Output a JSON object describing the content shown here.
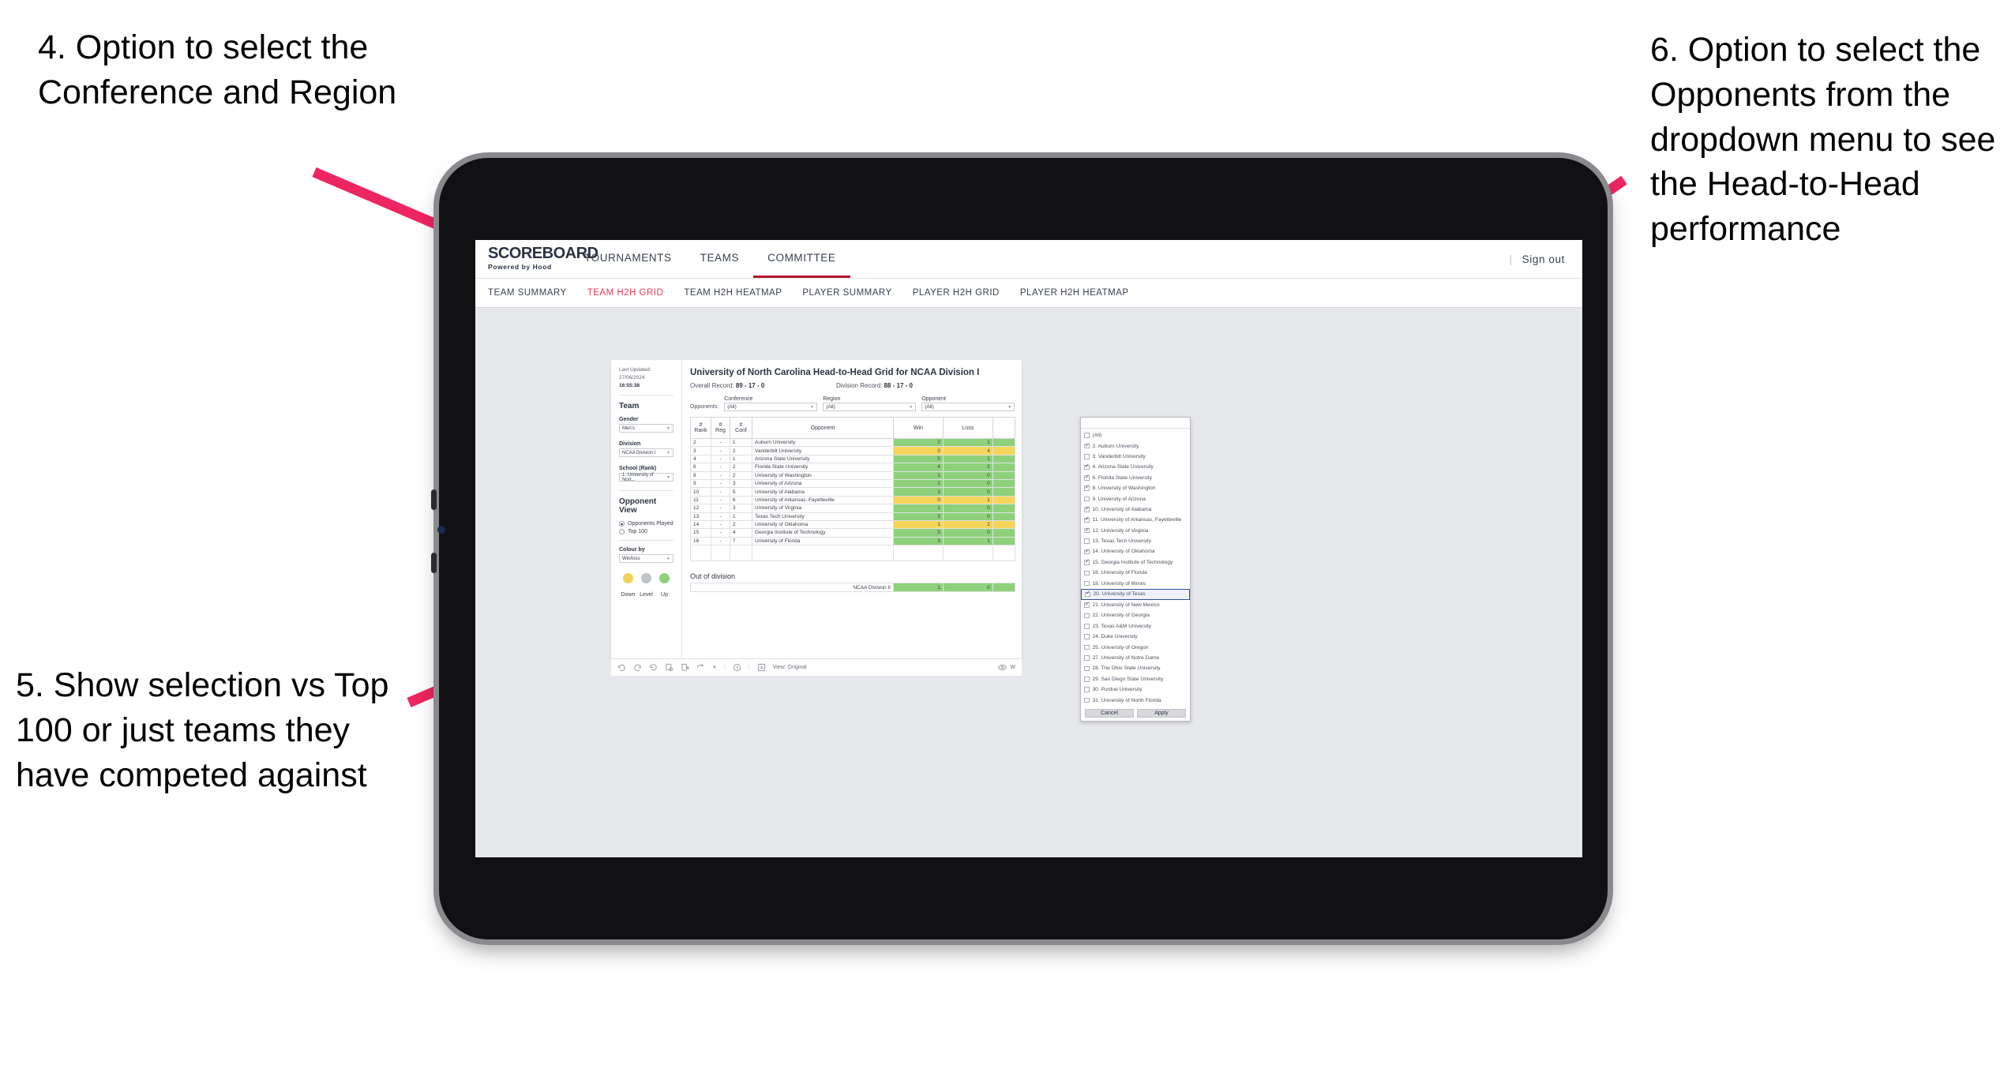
{
  "annotations": {
    "a4": "4. Option to select the Conference and Region",
    "a5": "5. Show selection vs Top 100 or just teams they have competed against",
    "a6": "6. Option to select the Opponents from the dropdown menu to see the Head-to-Head performance"
  },
  "colors": {
    "arrow": "#ED2560",
    "accent_red": "#B3152C",
    "active_tab": "#E8395C",
    "up_green": "#8ED17A",
    "down_yellow": "#F6D65A",
    "level_grey": "#BFC2C6",
    "desktop_bg": "#E7E8EC"
  },
  "app": {
    "brand": {
      "name": "SCOREBOARD",
      "tagline": "Powered by Hood"
    },
    "topnav": [
      {
        "label": "TOURNAMENTS",
        "active": false
      },
      {
        "label": "TEAMS",
        "active": false
      },
      {
        "label": "COMMITTEE",
        "active": true
      }
    ],
    "signout": {
      "divider": "|",
      "label": "Sign out"
    },
    "subnav": [
      {
        "label": "TEAM SUMMARY",
        "active": false
      },
      {
        "label": "TEAM H2H GRID",
        "active": true
      },
      {
        "label": "TEAM H2H HEATMAP",
        "active": false
      },
      {
        "label": "PLAYER SUMMARY",
        "active": false
      },
      {
        "label": "PLAYER H2H GRID",
        "active": false
      },
      {
        "label": "PLAYER H2H HEATMAP",
        "active": false
      }
    ]
  },
  "sidebar": {
    "last_updated_label": "Last Updated: 27/06/2024",
    "last_updated_time": "16:55:38",
    "team_heading": "Team",
    "gender_label": "Gender",
    "gender_value": "Men's",
    "division_label": "Division",
    "division_value": "NCAA Division I",
    "school_label": "School (Rank)",
    "school_value": "1. University of Nort...",
    "opponent_view_heading": "Opponent View",
    "opponent_view_options": [
      {
        "label": "Opponents Played",
        "selected": true
      },
      {
        "label": "Top 100",
        "selected": false
      }
    ],
    "colour_by_label": "Colour by",
    "colour_by_value": "Win/loss",
    "legend": [
      {
        "label": "Down",
        "color": "#F2D15B"
      },
      {
        "label": "Level",
        "color": "#BFC2C6"
      },
      {
        "label": "Up",
        "color": "#8ED17A"
      }
    ]
  },
  "main": {
    "title": "University of North Carolina Head-to-Head Grid for NCAA Division I",
    "overall_record_label": "Overall Record:",
    "overall_record_value": "89 - 17 - 0",
    "division_record_label": "Division Record:",
    "division_record_value": "88 - 17 - 0",
    "opponents_label": "Opponents:",
    "filters": [
      {
        "label": "Conference",
        "value": "(All)"
      },
      {
        "label": "Region",
        "value": "(All)"
      },
      {
        "label": "Opponent",
        "value": "(All)"
      }
    ],
    "columns": [
      "# Rank",
      "# Reg",
      "# Conf",
      "Opponent",
      "Win",
      "Loss"
    ],
    "column_head_lines": [
      [
        "#",
        "Rank"
      ],
      [
        "#",
        "Reg"
      ],
      [
        "#",
        "Conf"
      ],
      [
        "",
        "Opponent"
      ],
      [
        "",
        "Win"
      ],
      [
        "",
        "Loss"
      ]
    ],
    "rows": [
      {
        "rank": "2",
        "reg": "-",
        "conf": "1",
        "opponent": "Auburn University",
        "win": "2",
        "loss": "1",
        "state": "up"
      },
      {
        "rank": "3",
        "reg": "-",
        "conf": "2",
        "opponent": "Vanderbilt University",
        "win": "0",
        "loss": "4",
        "state": "down"
      },
      {
        "rank": "4",
        "reg": "-",
        "conf": "1",
        "opponent": "Arizona State University",
        "win": "5",
        "loss": "1",
        "state": "up"
      },
      {
        "rank": "6",
        "reg": "-",
        "conf": "2",
        "opponent": "Florida State University",
        "win": "4",
        "loss": "2",
        "state": "up"
      },
      {
        "rank": "8",
        "reg": "-",
        "conf": "2",
        "opponent": "University of Washington",
        "win": "1",
        "loss": "0",
        "state": "up"
      },
      {
        "rank": "9",
        "reg": "-",
        "conf": "3",
        "opponent": "University of Arizona",
        "win": "1",
        "loss": "0",
        "state": "up"
      },
      {
        "rank": "10",
        "reg": "-",
        "conf": "5",
        "opponent": "University of Alabama",
        "win": "3",
        "loss": "0",
        "state": "up"
      },
      {
        "rank": "11",
        "reg": "-",
        "conf": "6",
        "opponent": "University of Arkansas, Fayetteville",
        "win": "0",
        "loss": "1",
        "state": "down"
      },
      {
        "rank": "12",
        "reg": "-",
        "conf": "3",
        "opponent": "University of Virginia",
        "win": "1",
        "loss": "0",
        "state": "up"
      },
      {
        "rank": "13",
        "reg": "-",
        "conf": "1",
        "opponent": "Texas Tech University",
        "win": "3",
        "loss": "0",
        "state": "up"
      },
      {
        "rank": "14",
        "reg": "-",
        "conf": "2",
        "opponent": "University of Oklahoma",
        "win": "1",
        "loss": "2",
        "state": "down"
      },
      {
        "rank": "15",
        "reg": "-",
        "conf": "4",
        "opponent": "Georgia Institute of Technology",
        "win": "5",
        "loss": "0",
        "state": "up"
      },
      {
        "rank": "16",
        "reg": "-",
        "conf": "7",
        "opponent": "University of Florida",
        "win": "3",
        "loss": "1",
        "state": "up"
      }
    ],
    "out_of_division_heading": "Out of division",
    "out_of_division_row": {
      "label": "NCAA Division II",
      "win": "1",
      "loss": "0",
      "state": "up"
    }
  },
  "opponent_dropdown": {
    "items": [
      {
        "label": "(All)",
        "checked": false,
        "highlighted": false
      },
      {
        "label": "2. Auburn University",
        "checked": true,
        "highlighted": false
      },
      {
        "label": "3. Vanderbilt University",
        "checked": false,
        "highlighted": false
      },
      {
        "label": "4. Arizona State University",
        "checked": true,
        "highlighted": false
      },
      {
        "label": "6. Florida State University",
        "checked": true,
        "highlighted": false
      },
      {
        "label": "8. University of Washington",
        "checked": true,
        "highlighted": false
      },
      {
        "label": "9. University of Arizona",
        "checked": false,
        "highlighted": false
      },
      {
        "label": "10. University of Alabama",
        "checked": true,
        "highlighted": false
      },
      {
        "label": "11. University of Arkansas, Fayetteville",
        "checked": true,
        "highlighted": false
      },
      {
        "label": "12. University of Virginia",
        "checked": true,
        "highlighted": false
      },
      {
        "label": "13. Texas Tech University",
        "checked": false,
        "highlighted": false
      },
      {
        "label": "14. University of Oklahoma",
        "checked": true,
        "highlighted": false
      },
      {
        "label": "15. Georgia Institute of Technology",
        "checked": true,
        "highlighted": false
      },
      {
        "label": "16. University of Florida",
        "checked": false,
        "highlighted": false
      },
      {
        "label": "18. University of Illinois",
        "checked": false,
        "highlighted": false
      },
      {
        "label": "20. University of Texas",
        "checked": true,
        "highlighted": true
      },
      {
        "label": "21. University of New Mexico",
        "checked": true,
        "highlighted": false
      },
      {
        "label": "22. University of Georgia",
        "checked": false,
        "highlighted": false
      },
      {
        "label": "23. Texas A&M University",
        "checked": false,
        "highlighted": false
      },
      {
        "label": "24. Duke University",
        "checked": false,
        "highlighted": false
      },
      {
        "label": "25. University of Oregon",
        "checked": false,
        "highlighted": false
      },
      {
        "label": "27. University of Notre Dame",
        "checked": false,
        "highlighted": false
      },
      {
        "label": "28. The Ohio State University",
        "checked": false,
        "highlighted": false
      },
      {
        "label": "29. San Diego State University",
        "checked": false,
        "highlighted": false
      },
      {
        "label": "30. Purdue University",
        "checked": false,
        "highlighted": false
      },
      {
        "label": "31. University of North Florida",
        "checked": false,
        "highlighted": false
      }
    ],
    "cancel_label": "Cancel",
    "apply_label": "Apply"
  },
  "toolbar": {
    "view_label": "View: Original",
    "watch_label": "W"
  }
}
